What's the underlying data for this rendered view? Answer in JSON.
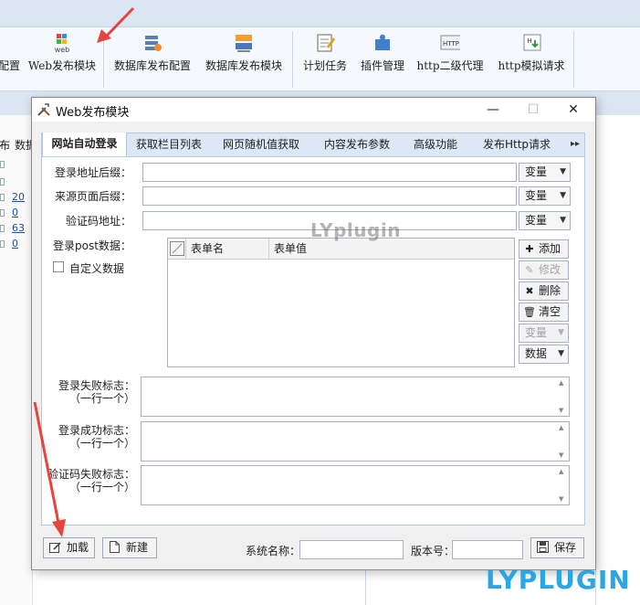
{
  "app": {
    "toolbar": {
      "partial_left_label": "配置",
      "web_publish": "Web发布模块",
      "db_publish_config": "数据库发布配置",
      "db_publish_module": "数据库发布模块",
      "scheduled_task": "计划任务",
      "plugin_manage": "插件管理",
      "http_proxy": "http二级代理",
      "http_simulate": "http模拟请求",
      "web_icon_text": "web",
      "http_icon_text": "HTTP",
      "http2_icon_text": "H"
    },
    "left_panel": {
      "col_partial_1": "布",
      "col_partial_2": "数据",
      "values": [
        "20",
        "0",
        "63",
        "0"
      ]
    }
  },
  "dialog": {
    "title": "Web发布模块",
    "controls": {
      "minimize": "—",
      "maximize": "☐",
      "close": "✕"
    },
    "tabs": [
      {
        "label": "网站自动登录",
        "active": true
      },
      {
        "label": "获取栏目列表",
        "active": false
      },
      {
        "label": "网页随机值获取",
        "active": false
      },
      {
        "label": "内容发布参数",
        "active": false
      },
      {
        "label": "高级功能",
        "active": false
      },
      {
        "label": "发布Http请求",
        "active": false
      }
    ],
    "tab_scroll_glyph": "▸▸",
    "form": {
      "login_url_suffix_label": "登录地址后缀：",
      "login_url_suffix_value": "",
      "referer_suffix_label": "来源页面后缀：",
      "referer_suffix_value": "",
      "captcha_url_label": "验证码地址：",
      "captcha_url_value": "",
      "variable_dropdown": "变量",
      "login_post_label": "登录post数据：",
      "custom_data_label": "自定义数据",
      "custom_data_checked": false,
      "grid": {
        "columns": [
          "表单名",
          "表单值"
        ],
        "rows": []
      },
      "side_buttons": {
        "add": "添加",
        "edit": "修改",
        "delete": "删除",
        "clear": "清空",
        "variable": "变量",
        "data": "数据"
      },
      "login_fail_label": "登录失败标志：",
      "login_success_label": "登录成功标志：",
      "captcha_fail_label": "验证码失败标志：",
      "one_per_line": "（一行一个）"
    },
    "bottom": {
      "load_button": "加载",
      "new_button": "新建",
      "system_name_label": "系统名称：",
      "system_name_value": "",
      "version_label": "版本号：",
      "version_value": "",
      "save_button": "保存"
    }
  },
  "watermarks": {
    "center": "LYplugin",
    "corner": "LYPLUGIN"
  },
  "colors": {
    "annotation_arrow": "#e8433f",
    "brand_watermark": "#2aa6e3",
    "tab_strip": "#dce8f6",
    "link": "#1a4fb0"
  }
}
